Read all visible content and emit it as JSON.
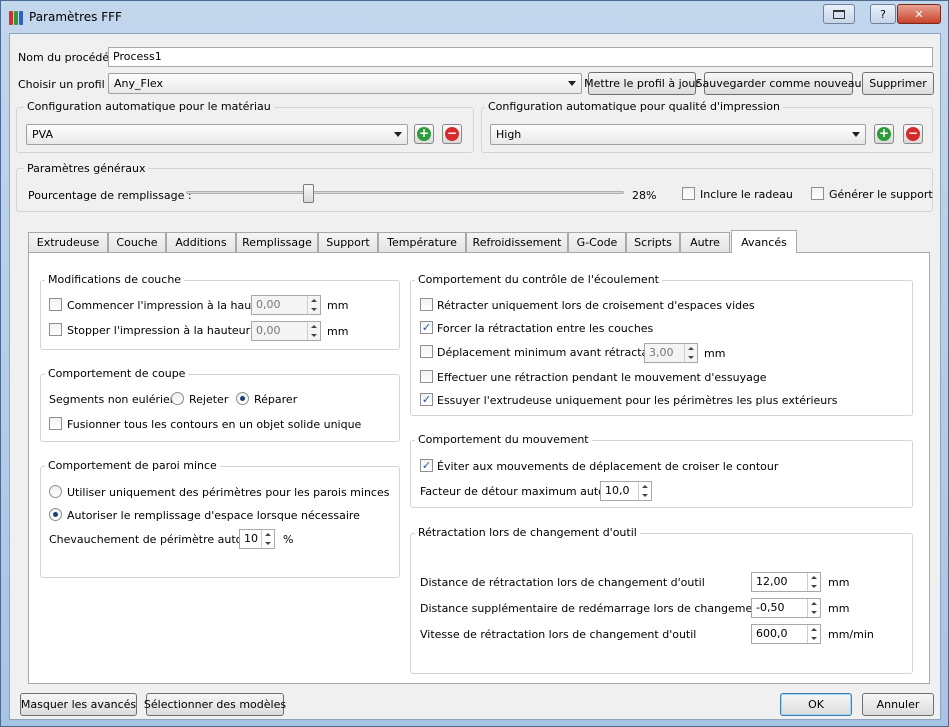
{
  "window": {
    "title": "Paramètres FFF",
    "help_label": "?",
    "close_label": "✕"
  },
  "top": {
    "process_label": "Nom du procédé :",
    "process_value": "Process1",
    "profile_label": "Choisir un profil :",
    "profile_value": "Any_Flex",
    "update_label": "Mettre le profil à jour",
    "save_new_label": "Sauvegarder comme nouveau",
    "delete_label": "Supprimer"
  },
  "auto_material": {
    "title": "Configuration automatique pour le matériau",
    "value": "PVA"
  },
  "auto_quality": {
    "title": "Configuration automatique pour qualité d'impression",
    "value": "High"
  },
  "general": {
    "title": "Paramètres généraux",
    "infill_label": "Pourcentage de remplissage :",
    "infill_value": "28%",
    "infill_fraction": 0.28,
    "raft_label": "Inclure le radeau",
    "support_label": "Générer le support"
  },
  "tabs": [
    "Extrudeuse",
    "Couche",
    "Additions",
    "Remplissage",
    "Support",
    "Température",
    "Refroidissement",
    "G-Code",
    "Scripts",
    "Autre",
    "Avancés"
  ],
  "layer_mod": {
    "title": "Modifications de couche",
    "start_label": "Commencer l'impression à la hauteur",
    "start_value": "0,00",
    "stop_label": "Stopper  l'impression à la hauteur",
    "stop_value": "0,00",
    "unit": "mm"
  },
  "cut": {
    "title": "Comportement de coupe",
    "segments_label": "Segments non eulérien :",
    "reject_label": "Rejeter",
    "repair_label": "Réparer",
    "merge_label": "Fusionner tous les contours en un objet solide unique"
  },
  "thin": {
    "title": "Comportement de paroi mince",
    "perim_only_label": "Utiliser uniquement des périmètres pour les parois minces",
    "allow_fill_label": "Autoriser le remplissage d'espace lorsque nécessaire",
    "overlap_label": "Chevauchement de périmètre autorisé",
    "overlap_value": "10",
    "overlap_unit": "%"
  },
  "flow": {
    "title": "Comportement du contrôle de l'écoulement",
    "retract_void_label": "Rétracter uniquement lors de croisement d'espaces vides",
    "force_retract_label": "Forcer la rétractation entre les couches",
    "min_travel_label": "Déplacement minimum avant rétractation",
    "min_travel_value": "3,00",
    "min_travel_unit": "mm",
    "wipe_retract_label": "Effectuer une rétraction pendant le mouvement d'essuyage",
    "wipe_outer_label": "Essuyer l'extrudeuse uniquement pour les périmètres les plus extérieurs"
  },
  "movement": {
    "title": "Comportement du mouvement",
    "avoid_label": "Éviter aux mouvements de déplacement de croiser le contour",
    "detour_label": "Facteur de détour maximum autorisé",
    "detour_value": "10,0"
  },
  "toolchange": {
    "title": "Rétractation lors de changement d'outil",
    "dist_label": "Distance de rétractation lors de changement d'outil",
    "dist_value": "12,00",
    "dist_unit": "mm",
    "extra_label": "Distance supplémentaire de redémarrage lors de changement d'outil",
    "extra_value": "-0,50",
    "extra_unit": "mm",
    "speed_label": "Vitesse de rétractation lors de changement d'outil",
    "speed_value": "600,0",
    "speed_unit": "mm/min"
  },
  "bottom": {
    "hide_advanced_label": "Masquer les avancés",
    "select_models_label": "Sélectionner des modèles",
    "ok_label": "OK",
    "cancel_label": "Annuler"
  },
  "checks": {
    "raft": false,
    "support": false,
    "start": false,
    "stop": false,
    "merge": false,
    "retract_void": false,
    "force_retract": true,
    "min_travel": false,
    "wipe_retract": false,
    "wipe_outer": true,
    "avoid": true
  },
  "colors": {
    "check": "#2456a4",
    "plus": "#2e9a3a",
    "minus": "#d42a2a"
  }
}
